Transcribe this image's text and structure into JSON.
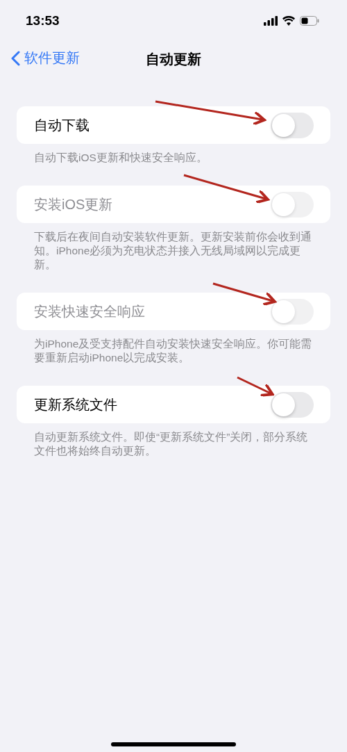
{
  "status_bar": {
    "time": "13:53"
  },
  "nav": {
    "back_label": "软件更新",
    "title": "自动更新"
  },
  "sections": [
    {
      "label": "自动下载",
      "on": false,
      "disabled": false,
      "arrow": true,
      "footer": "自动下载iOS更新和快速安全响应。"
    },
    {
      "label": "安装iOS更新",
      "on": false,
      "disabled": true,
      "arrow": true,
      "footer": "下载后在夜间自动安装软件更新。更新安装前你会收到通知。iPhone必须为充电状态并接入无线局域网以完成更新。"
    },
    {
      "label": "安装快速安全响应",
      "on": false,
      "disabled": true,
      "arrow": true,
      "footer": "为iPhone及受支持配件自动安装快速安全响应。你可能需要重新启动iPhone以完成安装。"
    },
    {
      "label": "更新系统文件",
      "on": false,
      "disabled": false,
      "arrow": true,
      "footer": "自动更新系统文件。即使“更新系统文件”关闭，部分系统文件也将始终自动更新。"
    }
  ]
}
